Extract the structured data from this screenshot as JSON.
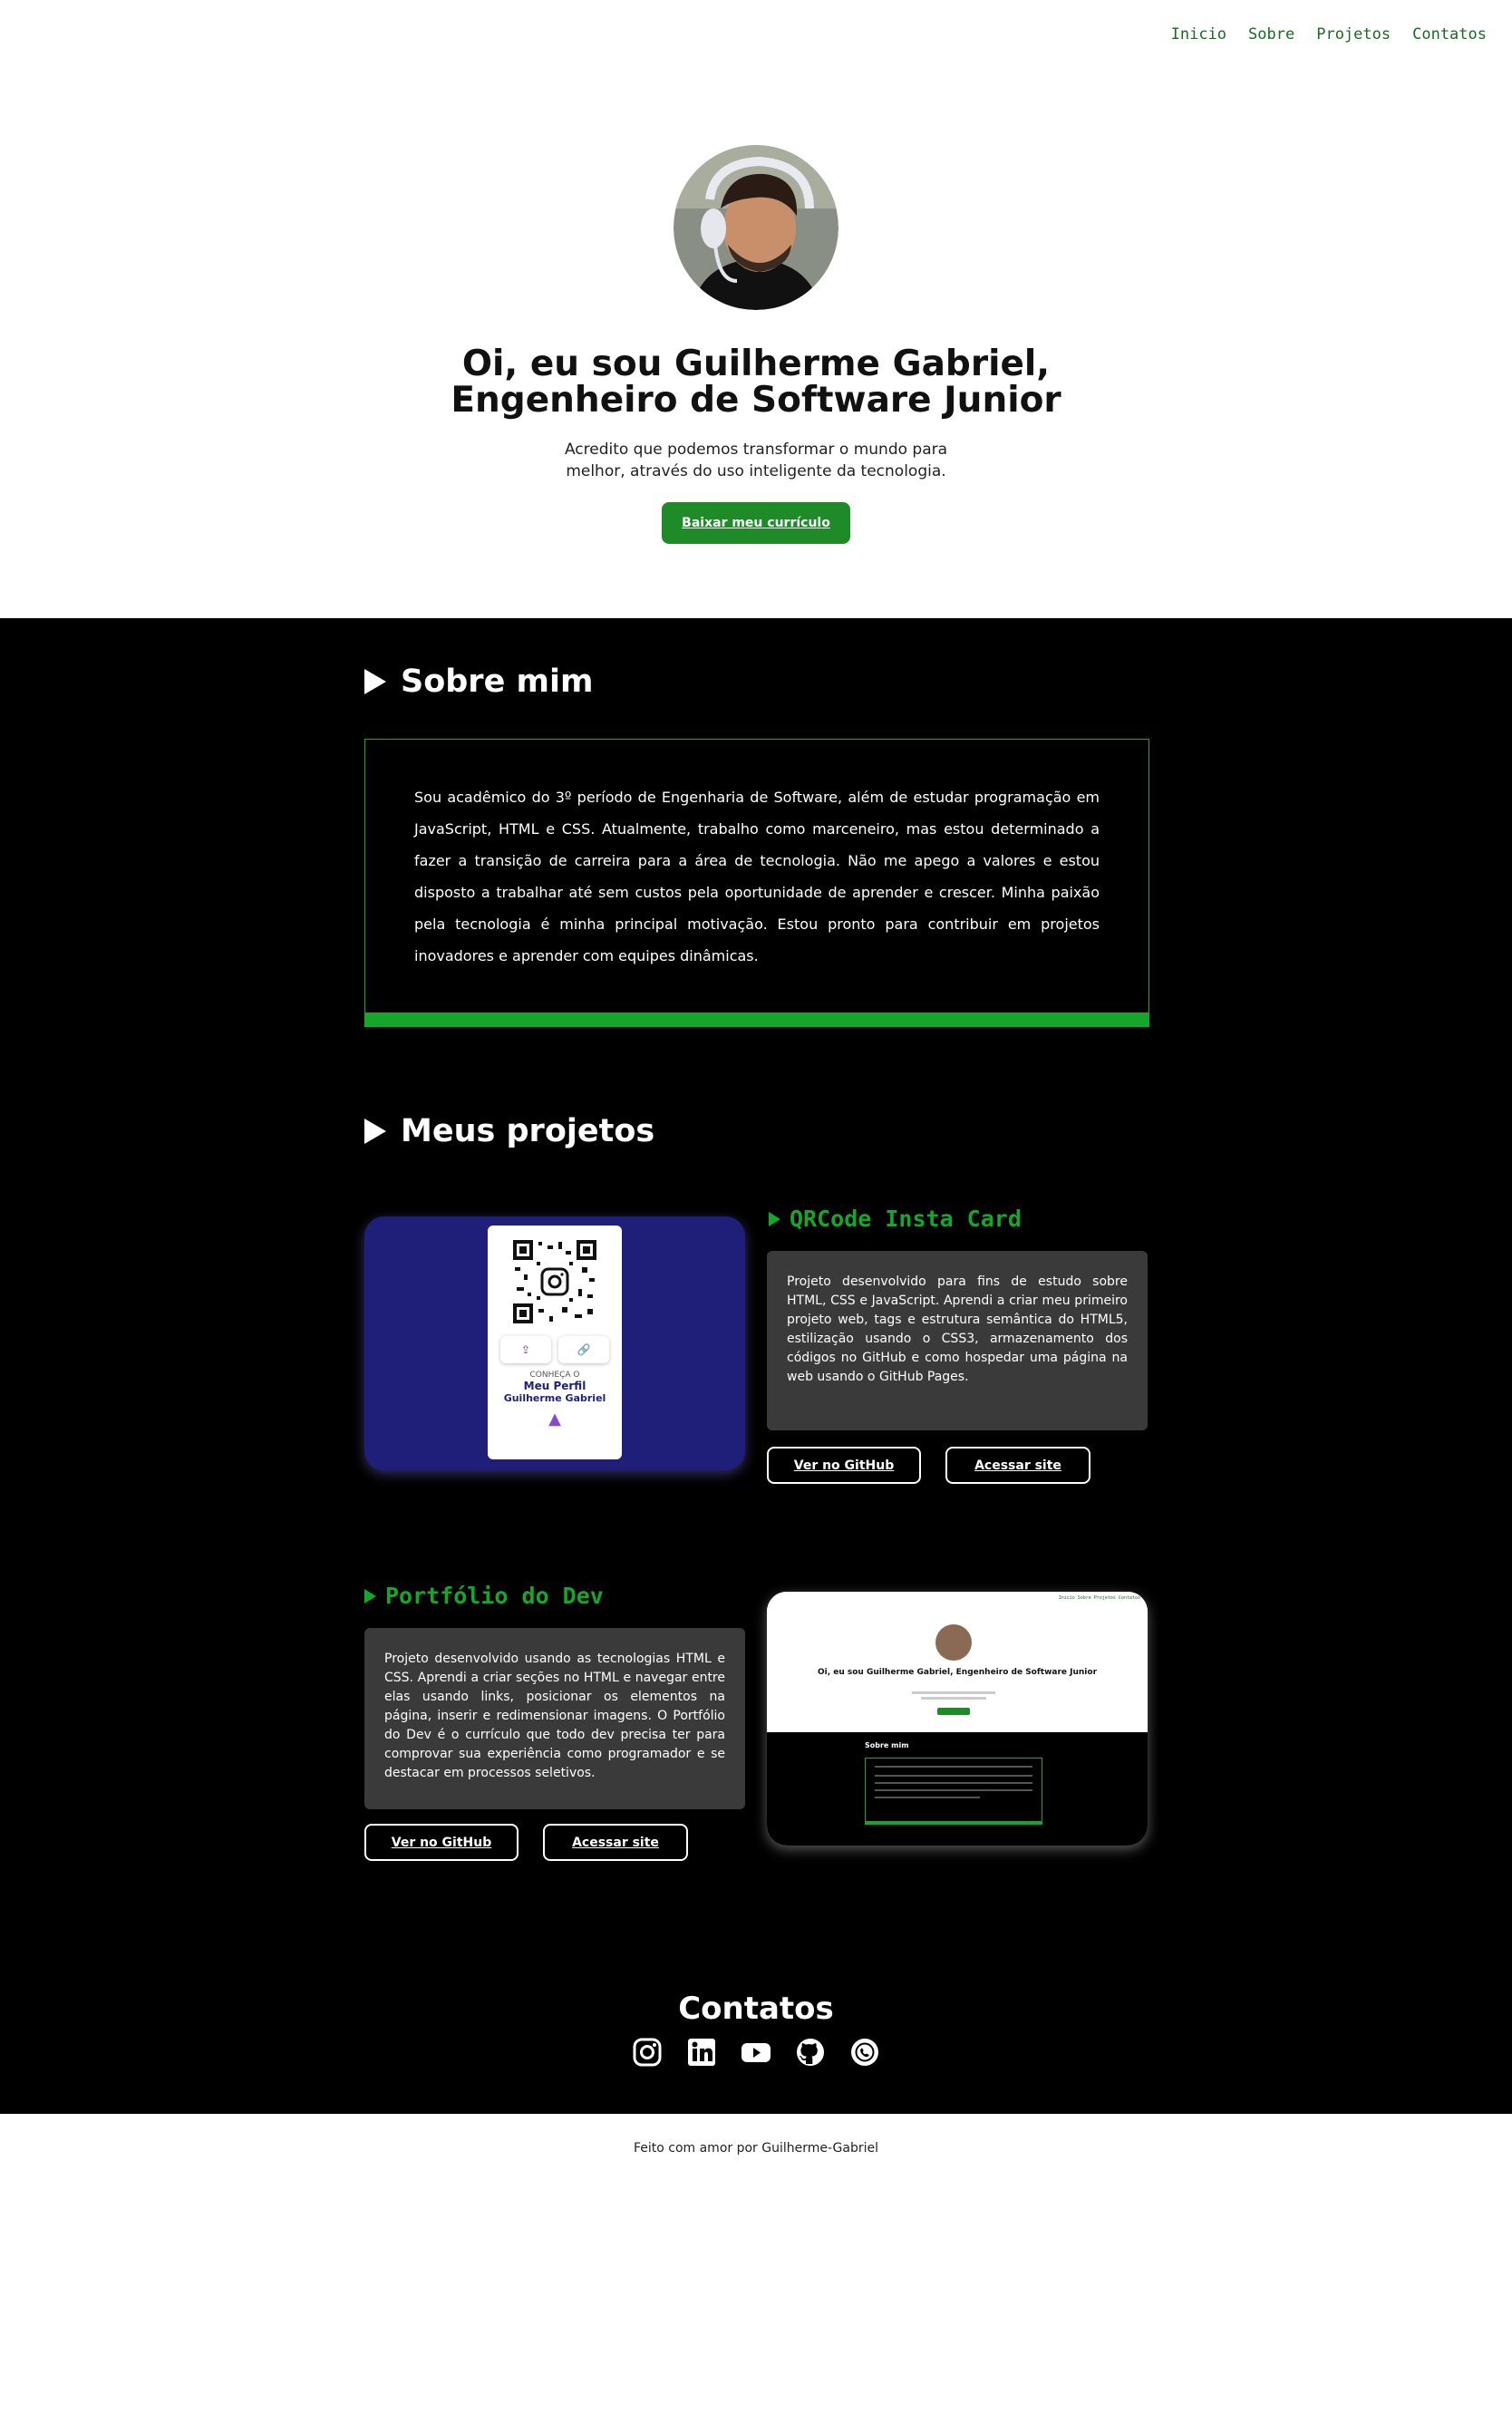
{
  "nav": {
    "items": [
      "Inicio",
      "Sobre",
      "Projetos",
      "Contatos"
    ]
  },
  "hero": {
    "title_line1": "Oi, eu sou Guilherme Gabriel,",
    "title_line2": "Engenheiro de Software Junior",
    "subtitle": "Acredito que podemos transformar o mundo para melhor, através do uso inteligente da tecnologia.",
    "cv_button": "Baixar meu currículo"
  },
  "about": {
    "heading": "Sobre mim",
    "text": "Sou acadêmico do 3º período de Engenharia de Software, além de estudar programação em JavaScript, HTML e CSS. Atualmente, trabalho como marceneiro, mas estou determinado a fazer a transição de carreira para a área de tecnologia. Não me apego a valores e estou disposto a trabalhar até sem custos pela oportunidade de aprender e crescer. Minha paixão pela tecnologia é minha principal motivação. Estou pronto para contribuir em projetos inovadores e aprender com equipes dinâmicas."
  },
  "projects": {
    "heading": "Meus projetos",
    "items": [
      {
        "title": "QRCode Insta Card",
        "description": "Projeto desenvolvido para fins de estudo sobre HTML, CSS e JavaScript. Aprendi a criar meu primeiro projeto web, tags e estrutura semântica do HTML5, estilização usando o CSS3, armazenamento dos códigos no GitHub e como hospedar uma página na web usando o GitHub Pages.",
        "github_button": "Ver no GitHub",
        "site_button": "Acessar site",
        "preview": {
          "label1": "CONHEÇA O",
          "label2": "Meu Perfil",
          "label3": "Guilherme Gabriel"
        }
      },
      {
        "title": "Portfólio do Dev",
        "description": "Projeto desenvolvido usando as tecnologias HTML e CSS. Aprendi a criar seções no HTML e navegar entre elas usando links, posicionar os elementos na página, inserir e redimensionar imagens. O Portfólio do Dev é o currículo que todo dev precisa ter para comprovar sua experiência como programador e se destacar em processos seletivos.",
        "github_button": "Ver no GitHub",
        "site_button": "Acessar site",
        "preview": {
          "title": "Oi, eu sou Guilherme Gabriel, Engenheiro de Software Junior",
          "section": "Sobre mim"
        }
      }
    ]
  },
  "contacts": {
    "heading": "Contatos",
    "icons": [
      "instagram-icon",
      "linkedin-icon",
      "youtube-icon",
      "github-icon",
      "whatsapp-icon"
    ]
  },
  "footer": {
    "text": "Feito com amor por Guilherme-Gabriel"
  },
  "colors": {
    "accent_green": "#14a72a",
    "button_green": "#1e8a28",
    "dark_bg": "#000000",
    "card_bg": "#3a3a3a",
    "qr_card_bg": "#1f1f7a"
  }
}
